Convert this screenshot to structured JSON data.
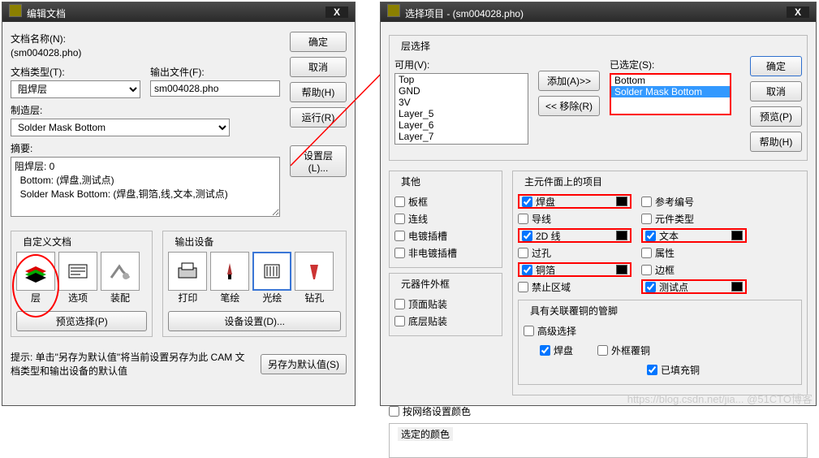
{
  "dlg1": {
    "title": "编辑文档",
    "docname_lbl": "文档名称(N):",
    "docname_val": "(sm004028.pho)",
    "doctype_lbl": "文档类型(T):",
    "doctype_val": "阻焊层",
    "outfile_lbl": "输出文件(F):",
    "outfile_val": "sm004028.pho",
    "fablayer_lbl": "制造层:",
    "fablayer_val": "Solder Mask Bottom",
    "summary_lbl": "摘要:",
    "summary_val": "阻焊层: 0\n  Bottom: (焊盘,测试点)\n  Solder Mask Bottom: (焊盘,铜箔,线,文本,测试点)",
    "custom_lbl": "自定义文档",
    "outdev_lbl": "输出设备",
    "icons": {
      "layer": "层",
      "option": "选项",
      "assy": "装配",
      "print": "打印",
      "pen": "笔绘",
      "photo": "光绘",
      "drill": "钻孔"
    },
    "preview_sel": "预览选择(P)",
    "device_set": "设备设置(D)...",
    "btns": {
      "ok": "确定",
      "cancel": "取消",
      "help": "帮助(H)",
      "run": "运行(R)",
      "setlayer": "设置层(L)...",
      "savedef": "另存为默认值(S)"
    },
    "tip": "提示: 单击\"另存为默认值\"将当前设置另存为此 CAM 文档类型和输出设备的默认值"
  },
  "dlg2": {
    "title": "选择项目 - (sm004028.pho)",
    "layersel": "层选择",
    "avail_lbl": "可用(V):",
    "avail": [
      "Top",
      "GND",
      "3V",
      "Layer_5",
      "Layer_6",
      "Layer_7"
    ],
    "selected_lbl": "已选定(S):",
    "selected": [
      "Bottom",
      "Solder Mask Bottom"
    ],
    "add": "添加(A)>>",
    "remove": "<< 移除(R)",
    "other": "其他",
    "other_items": {
      "board": "板框",
      "conn": "连线",
      "plated": "电镀插槽",
      "nonplat": "非电镀插槽"
    },
    "outline": "元器件外框",
    "outline_items": {
      "top": "顶面贴装",
      "bot": "底层贴装"
    },
    "main": "主元件面上的项目",
    "main_items": {
      "pad": "焊盘",
      "trace": "导线",
      "2d": "2D 线",
      "via": "过孔",
      "cu": "铜箔",
      "keep": "禁止区域",
      "ref": "参考编号",
      "ptype": "元件类型",
      "text": "文本",
      "attr": "属性",
      "edge": "边框",
      "test": "测试点"
    },
    "assoc": "具有关联覆铜的管脚",
    "adv": "高级选择",
    "padcu": "焊盘",
    "outcu": "外框覆铜",
    "filled": "已填充铜",
    "bynet": "按网络设置颜色",
    "selcolor": "选定的颜色",
    "btns": {
      "ok": "确定",
      "cancel": "取消",
      "preview": "预览(P)",
      "help": "帮助(H)"
    }
  },
  "watermark": "https://blog.csdn.net/jia... @51CTO博客"
}
